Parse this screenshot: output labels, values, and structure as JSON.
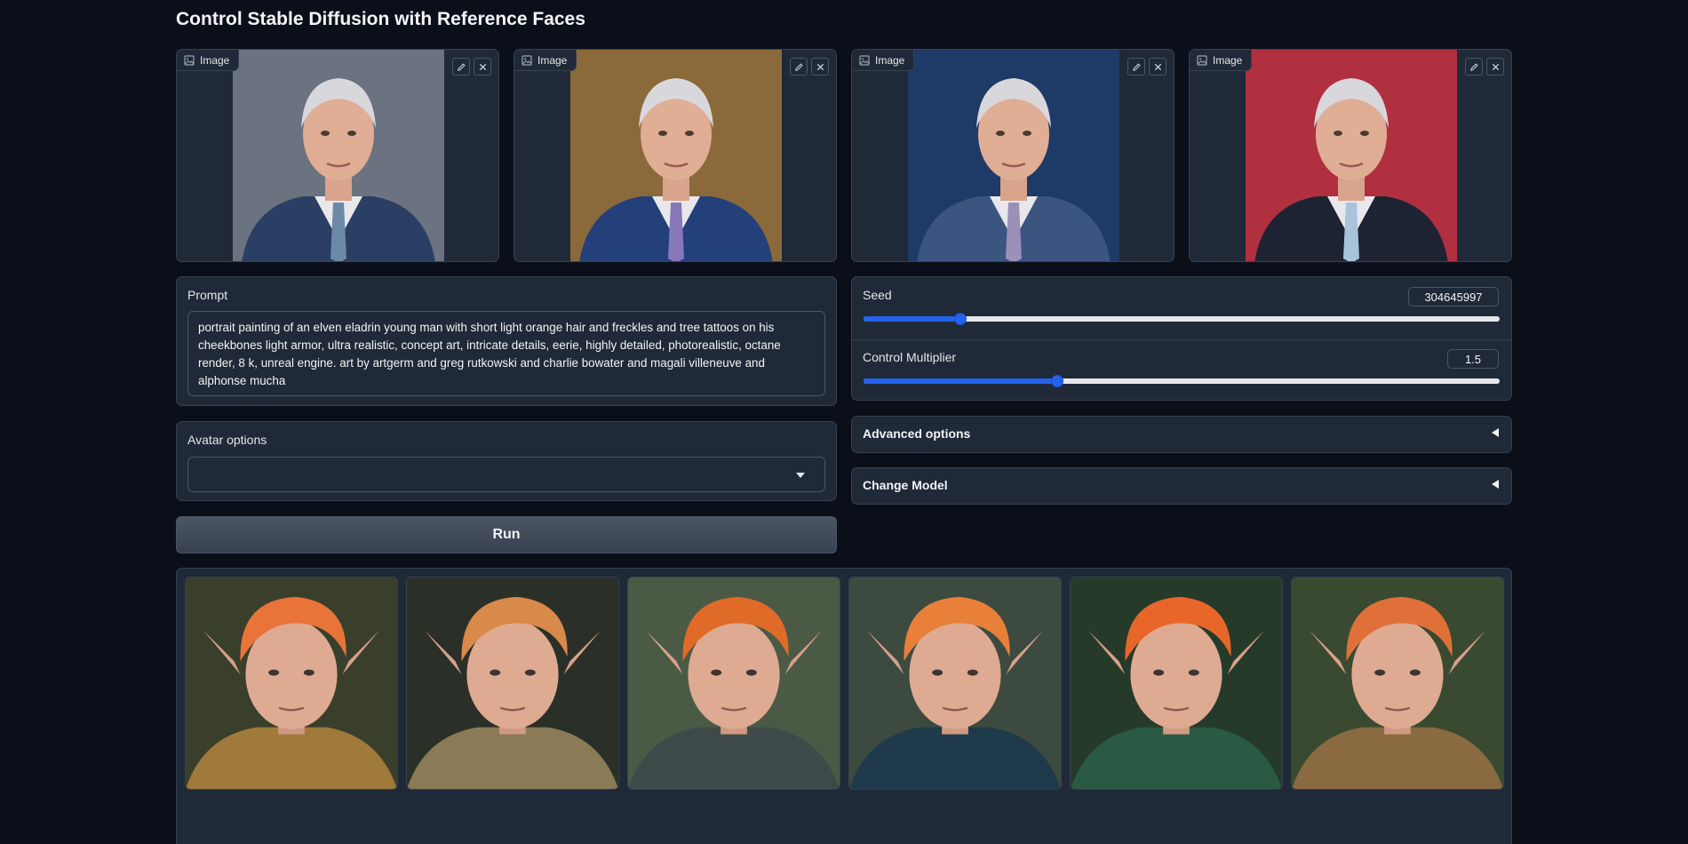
{
  "page": {
    "title": "Control Stable Diffusion with Reference Faces"
  },
  "reference_images": [
    {
      "label": "Image",
      "edit_icon": "pencil-icon",
      "clear_icon": "close-icon",
      "background": "#6b7280",
      "suit": "#2b3e63",
      "tie": "#6a8aa8"
    },
    {
      "label": "Image",
      "edit_icon": "pencil-icon",
      "clear_icon": "close-icon",
      "background": "#8a6a3a",
      "suit": "#23407a",
      "tie": "#8878b8"
    },
    {
      "label": "Image",
      "edit_icon": "pencil-icon",
      "clear_icon": "close-icon",
      "background": "#1e3a66",
      "suit": "#3b5580",
      "tie": "#9a90b8"
    },
    {
      "label": "Image",
      "edit_icon": "pencil-icon",
      "clear_icon": "close-icon",
      "background": "#b03040",
      "suit": "#1d2333",
      "tie": "#a9c4da"
    }
  ],
  "prompt": {
    "label": "Prompt",
    "value": "portrait painting of an elven eladrin young man with short light orange hair and freckles and tree tattoos on his cheekbones light armor, ultra realistic, concept art, intricate details, eerie, highly detailed, photorealistic, octane render, 8 k, unreal engine. art by artgerm and greg rutkowski and charlie bowater and magali villeneuve and alphonse mucha"
  },
  "avatar": {
    "label": "Avatar options",
    "selected": ""
  },
  "run": {
    "label": "Run"
  },
  "seed": {
    "label": "Seed",
    "value": "304645997",
    "fraction": 0.152
  },
  "control_multiplier": {
    "label": "Control Multiplier",
    "value": "1.5",
    "fraction": 0.305
  },
  "advanced": {
    "label": "Advanced options"
  },
  "change_model": {
    "label": "Change Model"
  },
  "colors": {
    "accent": "#2563eb",
    "panel": "#1f2937",
    "background": "#0b0f19"
  },
  "gallery": [
    {
      "bg": "#3a3f2c",
      "hair": "#e8743a",
      "armor": "#a07a3a"
    },
    {
      "bg": "#2a3028",
      "hair": "#d9894a",
      "armor": "#8a7a55"
    },
    {
      "bg": "#4a5a45",
      "hair": "#e06a28",
      "armor": "#3e4a4a"
    },
    {
      "bg": "#3c4a40",
      "hair": "#e8803a",
      "armor": "#1f3a4a"
    },
    {
      "bg": "#263a2a",
      "hair": "#e8662a",
      "armor": "#2a5a44"
    },
    {
      "bg": "#3a4a30",
      "hair": "#e0703a",
      "armor": "#8a6a40"
    }
  ]
}
